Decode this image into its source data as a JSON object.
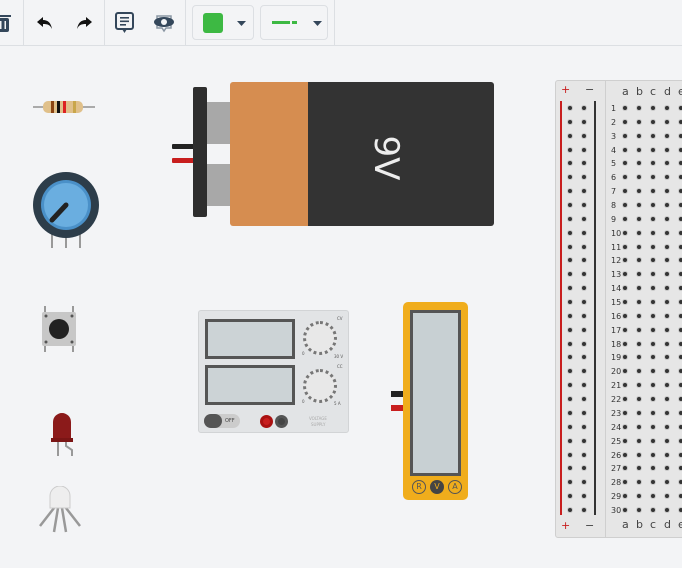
{
  "toolbar": {
    "buttons": [
      {
        "name": "delete-button",
        "icon": "trash-icon"
      },
      {
        "name": "undo-button",
        "icon": "undo-icon"
      },
      {
        "name": "redo-button",
        "icon": "redo-icon"
      },
      {
        "name": "notes-button",
        "icon": "notes-icon"
      },
      {
        "name": "visibility-button",
        "icon": "eye-icon"
      }
    ],
    "color_picker": {
      "selected_color": "#3db943"
    },
    "wire_type": {
      "color": "#3db943"
    }
  },
  "battery": {
    "label": "9V"
  },
  "power_supply": {
    "knob1_label": "CV",
    "knob1_min": "0",
    "knob1_max": "30 V",
    "knob2_label": "CC",
    "knob2_min": "0",
    "knob2_max": "5 A",
    "switch_label": "OFF",
    "brand_line1": "VOLTAGE",
    "brand_line2": "SUPPLY"
  },
  "multimeter": {
    "modes": [
      "R",
      "V",
      "A"
    ],
    "selected_mode": "V"
  },
  "breadboard": {
    "rail_plus": "+",
    "rail_minus": "−",
    "columns": [
      "a",
      "b",
      "c",
      "d",
      "e"
    ],
    "rows": [
      "1",
      "2",
      "3",
      "4",
      "5",
      "6",
      "7",
      "8",
      "9",
      "10",
      "11",
      "12",
      "13",
      "14",
      "15",
      "16",
      "17",
      "18",
      "19",
      "20",
      "21",
      "22",
      "23",
      "24",
      "25",
      "26",
      "27",
      "28",
      "29",
      "30"
    ]
  }
}
